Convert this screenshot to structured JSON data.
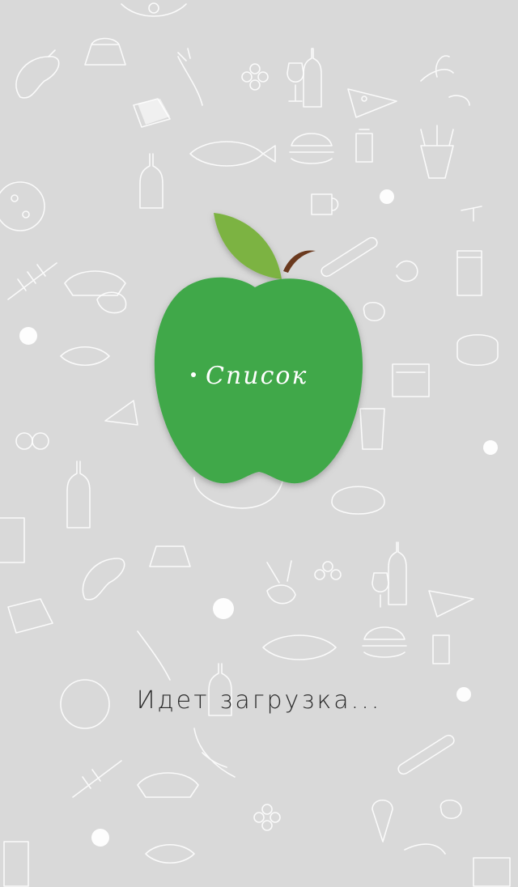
{
  "app": {
    "logo_text": "Список"
  },
  "status": {
    "loading_text": "Идет загрузка..."
  },
  "colors": {
    "background": "#d9d9d9",
    "apple_green": "#41a84a",
    "leaf_green": "#7cb342",
    "stem_brown": "#6b3a1f",
    "doodle_stroke": "#ffffff"
  },
  "icons": {
    "logo": "green-apple-icon",
    "background_pattern": "food-doodle-pattern"
  }
}
